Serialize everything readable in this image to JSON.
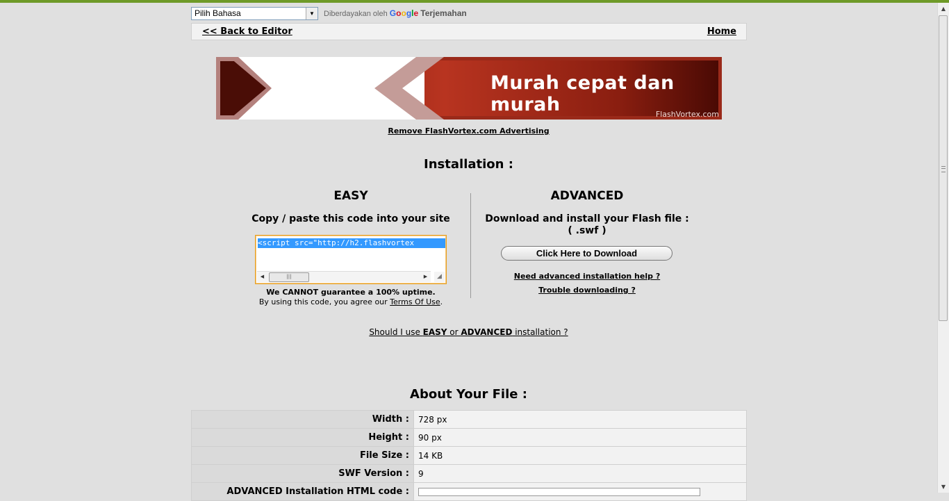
{
  "translate": {
    "select_value": "Pilih Bahasa",
    "powered_by": "Diberdayakan oleh",
    "google": "Google",
    "service": "Terjemahan"
  },
  "nav": {
    "back_label": "<< Back to Editor",
    "home_label": "Home"
  },
  "banner": {
    "message": "Murah cepat dan murah",
    "brand": "FlashVortex.com"
  },
  "remove_ad_label": "Remove FlashVortex.com Advertising",
  "installation_title": "Installation :",
  "easy": {
    "title": "EASY",
    "subtitle": "Copy / paste this code into your site",
    "code": "<script src=\"http://h2.flashvortex",
    "uptime": "We CANNOT guarantee a 100% uptime.",
    "agree_prefix": "By using this code, you agree our ",
    "terms_label": "Terms Of Use",
    "agree_suffix": "."
  },
  "advanced": {
    "title": "ADVANCED",
    "subtitle_line1": "Download and install your Flash file :",
    "subtitle_line2": "( .swf )",
    "download_label": "Click Here to Download",
    "help_label": "Need advanced installation help ?",
    "trouble_label": "Trouble downloading ?"
  },
  "should": {
    "prefix": "Should I use ",
    "easy": "EASY",
    "or": " or ",
    "advanced": "ADVANCED",
    "suffix": " installation ?"
  },
  "about_title": "About Your File :",
  "file_info": [
    {
      "label": "Width :",
      "value": "728 px"
    },
    {
      "label": "Height :",
      "value": "90 px"
    },
    {
      "label": "File Size :",
      "value": "14 KB"
    },
    {
      "label": "SWF Version :",
      "value": "9"
    },
    {
      "label": "ADVANCED Installation HTML code :",
      "value": ""
    }
  ],
  "colors": {
    "top_line": "#6e9a28",
    "page_bg": "#e0e0e0",
    "code_selection": "#3399ff",
    "code_border": "#e8a020"
  }
}
